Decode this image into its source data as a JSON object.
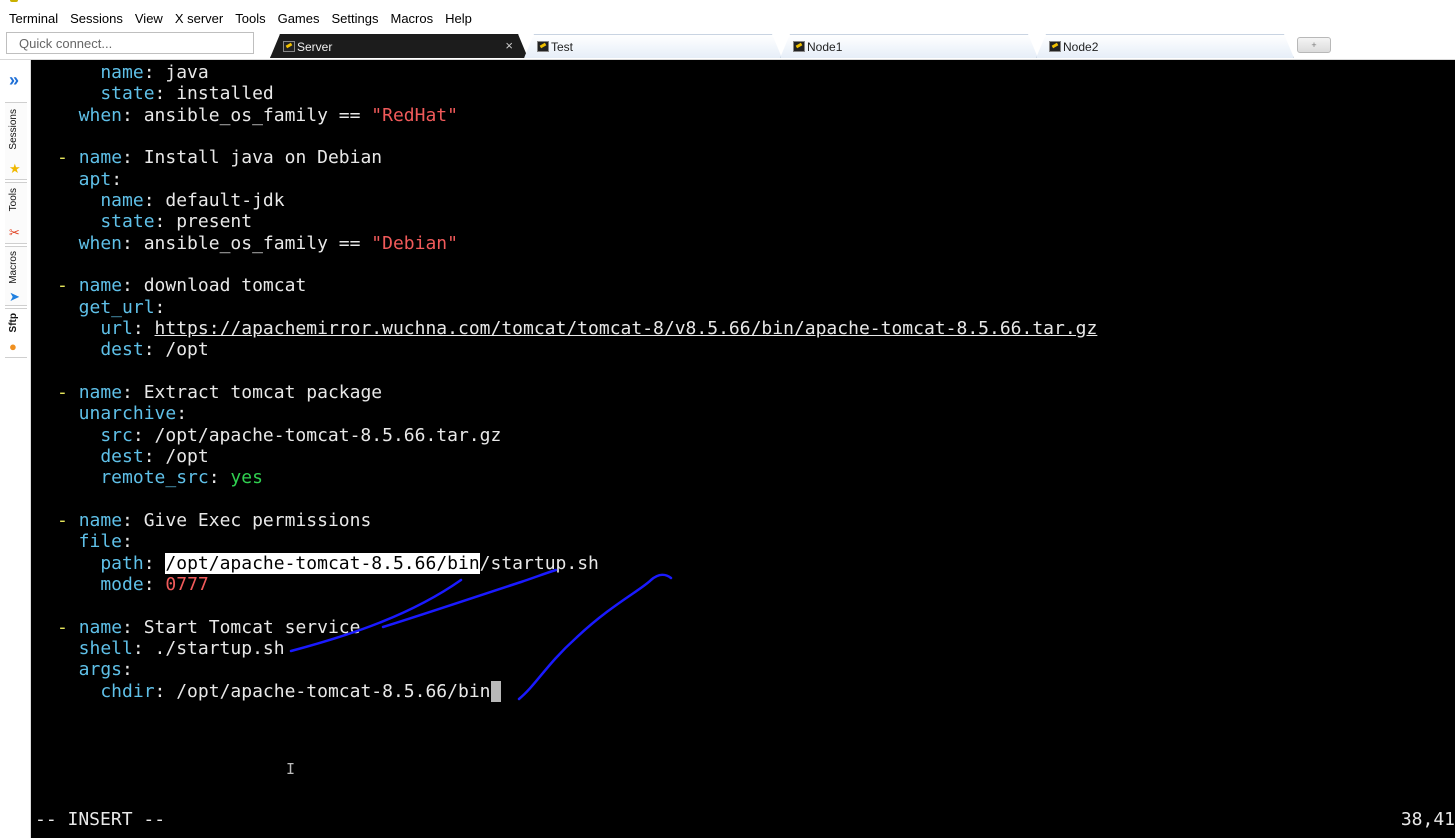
{
  "menu": [
    "Terminal",
    "Sessions",
    "View",
    "X server",
    "Tools",
    "Games",
    "Settings",
    "Macros",
    "Help"
  ],
  "quick_connect": {
    "placeholder": "Quick connect..."
  },
  "tabs": [
    {
      "label": "Server",
      "close": "×"
    },
    {
      "label": "Test"
    },
    {
      "label": "Node1"
    },
    {
      "label": "Node2"
    }
  ],
  "new_tab": "+",
  "sidebar": {
    "chevron": "»",
    "items": [
      {
        "label": "Sessions",
        "icon": "star-icon"
      },
      {
        "label": "Tools",
        "icon": "tools-icon"
      },
      {
        "label": "Macros",
        "icon": "send-icon"
      },
      {
        "label": "Sftp",
        "icon": "sftp-icon"
      }
    ]
  },
  "editor": {
    "lines": [
      [
        [
          "k",
          "    name"
        ],
        [
          "t",
          ": java"
        ]
      ],
      [
        [
          "k",
          "    state"
        ],
        [
          "t",
          ": installed"
        ]
      ],
      [
        [
          "k",
          "  when"
        ],
        [
          "t",
          ": ansible_os_family == "
        ],
        [
          "s",
          "\"RedHat\""
        ]
      ],
      [],
      [
        [
          "d",
          "- "
        ],
        [
          "k",
          "name"
        ],
        [
          "t",
          ": Install java on Debian"
        ]
      ],
      [
        [
          "k",
          "  apt"
        ],
        [
          "t",
          ":"
        ]
      ],
      [
        [
          "k",
          "    name"
        ],
        [
          "t",
          ": default-jdk"
        ]
      ],
      [
        [
          "k",
          "    state"
        ],
        [
          "t",
          ": present"
        ]
      ],
      [
        [
          "k",
          "  when"
        ],
        [
          "t",
          ": ansible_os_family == "
        ],
        [
          "s",
          "\"Debian\""
        ]
      ],
      [],
      [
        [
          "d",
          "- "
        ],
        [
          "k",
          "name"
        ],
        [
          "t",
          ": download tomcat"
        ]
      ],
      [
        [
          "k",
          "  get_url"
        ],
        [
          "t",
          ":"
        ]
      ],
      [
        [
          "k",
          "    url"
        ],
        [
          "t",
          ": "
        ],
        [
          "u",
          "https://apachemirror.wuchna.com/tomcat/tomcat-8/v8.5.66/bin/apache-tomcat-8.5.66.tar.gz"
        ]
      ],
      [
        [
          "k",
          "    dest"
        ],
        [
          "t",
          ": /opt"
        ]
      ],
      [],
      [
        [
          "d",
          "- "
        ],
        [
          "k",
          "name"
        ],
        [
          "t",
          ": Extract tomcat package"
        ]
      ],
      [
        [
          "k",
          "  unarchive"
        ],
        [
          "t",
          ":"
        ]
      ],
      [
        [
          "k",
          "    src"
        ],
        [
          "t",
          ": /opt/apache-tomcat-8.5.66.tar.gz"
        ]
      ],
      [
        [
          "k",
          "    dest"
        ],
        [
          "t",
          ": /opt"
        ]
      ],
      [
        [
          "k",
          "    remote_src"
        ],
        [
          "t",
          ": "
        ],
        [
          "y",
          "yes"
        ]
      ],
      [],
      [
        [
          "d",
          "- "
        ],
        [
          "k",
          "name"
        ],
        [
          "t",
          ": Give Exec permissions"
        ]
      ],
      [
        [
          "k",
          "  file"
        ],
        [
          "t",
          ":"
        ]
      ],
      [
        [
          "k",
          "    path"
        ],
        [
          "t",
          ": "
        ],
        [
          "hl",
          "/opt/apache-tomcat-8.5.66/bin"
        ],
        [
          "t",
          "/startup.sh"
        ]
      ],
      [
        [
          "k",
          "    mode"
        ],
        [
          "t",
          ": "
        ],
        [
          "n",
          "0777"
        ]
      ],
      [],
      [
        [
          "d",
          "- "
        ],
        [
          "k",
          "name"
        ],
        [
          "t",
          ": Start Tomcat service"
        ]
      ],
      [
        [
          "k",
          "  shell"
        ],
        [
          "t",
          ": ./startup.sh"
        ]
      ],
      [
        [
          "k",
          "  args"
        ],
        [
          "t",
          ":"
        ]
      ],
      [
        [
          "k",
          "    chdir"
        ],
        [
          "t",
          ": /opt/apache-tomcat-8.5.66/bin"
        ],
        [
          "c",
          " "
        ]
      ]
    ],
    "mode": "-- INSERT --",
    "position": "38,41"
  },
  "colors": {
    "key": "#5fc0e8",
    "dash": "#e6e65a",
    "string": "#f05a5a",
    "boolean": "#30d050",
    "annotation": "#1a1aff"
  }
}
